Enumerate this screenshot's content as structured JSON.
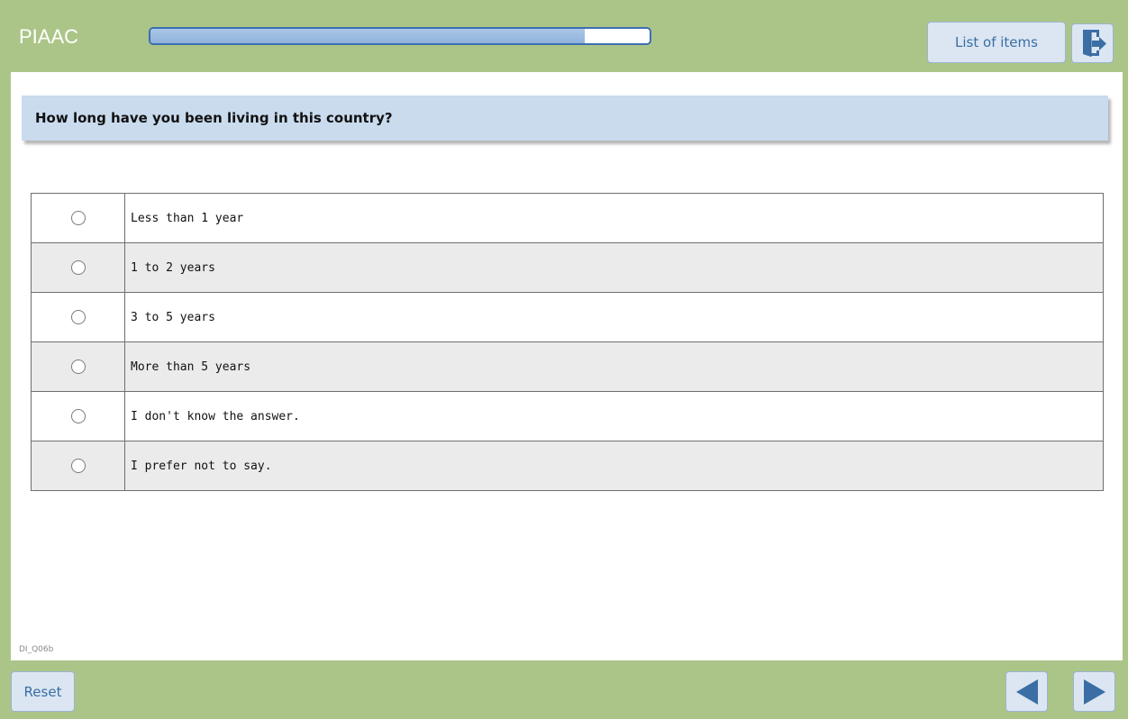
{
  "header": {
    "title": "PIAAC",
    "progress": 0.87,
    "list_label": "List of items",
    "exit_icon": "exit-door-icon"
  },
  "question": {
    "text": "How long have you been living in this country?",
    "options": [
      {
        "label": "Less than 1 year"
      },
      {
        "label": "1 to 2 years"
      },
      {
        "label": "3 to 5 years"
      },
      {
        "label": "More than 5 years"
      },
      {
        "label": "I don't know the answer."
      },
      {
        "label": "I prefer not to say."
      }
    ]
  },
  "item_code": "DI_Q06b",
  "footer": {
    "reset_label": "Reset",
    "prev_icon": "arrow-left-icon",
    "next_icon": "arrow-right-icon"
  },
  "colors": {
    "frame": "#abc588",
    "accent": "#3b6fb0",
    "button_bg": "#dbe6f2",
    "question_bg": "#c9dbed",
    "row_alt": "#ebebeb"
  }
}
